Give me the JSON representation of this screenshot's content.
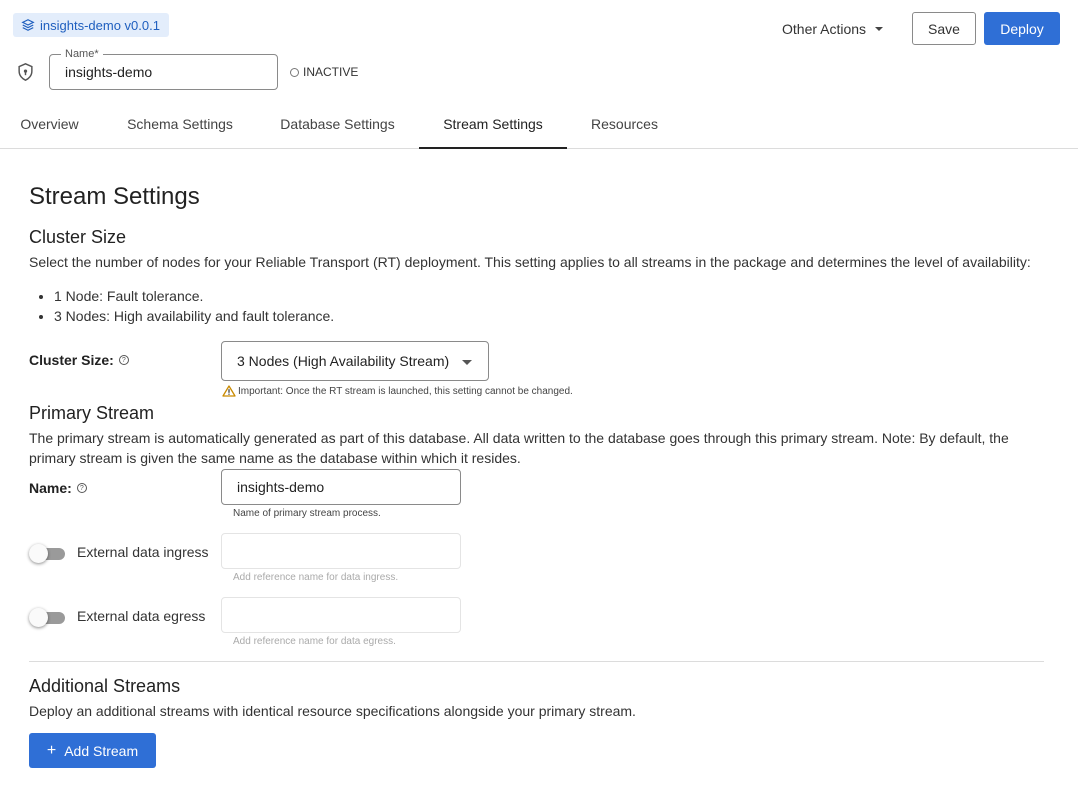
{
  "header": {
    "version_chip": "insights-demo v0.0.1",
    "name_field": {
      "legend": "Name*",
      "value": "insights-demo"
    },
    "status": "INACTIVE",
    "other_actions": "Other Actions",
    "save_label": "Save",
    "deploy_label": "Deploy"
  },
  "tabs": [
    {
      "label": "Overview"
    },
    {
      "label": "Schema Settings"
    },
    {
      "label": "Database Settings"
    },
    {
      "label": "Stream Settings",
      "active": true
    },
    {
      "label": "Resources"
    }
  ],
  "main": {
    "title": "Stream Settings",
    "cluster": {
      "heading": "Cluster Size",
      "description": "Select the number of nodes for your Reliable Transport (RT) deployment. This setting applies to all streams in the package and determines the level of availability:",
      "bullets": [
        "1 Node: Fault tolerance.",
        "3 Nodes: High availability and fault tolerance."
      ],
      "field_label": "Cluster Size:",
      "selected": "3 Nodes (High Availability Stream)",
      "warning": "Important: Once the RT stream is launched, this setting cannot be changed."
    },
    "primary": {
      "heading": "Primary Stream",
      "description": "The primary stream is automatically generated as part of this database. All data written to the database goes through this primary stream. Note: By default, the primary stream is given the same name as the database within which it resides.",
      "name_label": "Name:",
      "name_value": "insights-demo",
      "name_hint": "Name of primary stream process.",
      "ingress_label": "External data ingress",
      "ingress_hint": "Add reference name for data ingress.",
      "egress_label": "External data egress",
      "egress_hint": "Add reference name for data egress."
    },
    "additional": {
      "heading": "Additional Streams",
      "description": "Deploy an additional streams with identical resource specifications alongside your primary stream.",
      "add_label": "Add Stream"
    }
  },
  "colors": {
    "accent": "#2f6fd6",
    "chip_bg": "#e3edfb",
    "chip_text": "#1f5fbf",
    "warning": "#c98a00"
  },
  "icons": {
    "version": "stack-icon",
    "shield": "shield-icon",
    "help": "help-circle-icon",
    "warning": "warning-triangle-icon",
    "add": "plus-icon"
  }
}
